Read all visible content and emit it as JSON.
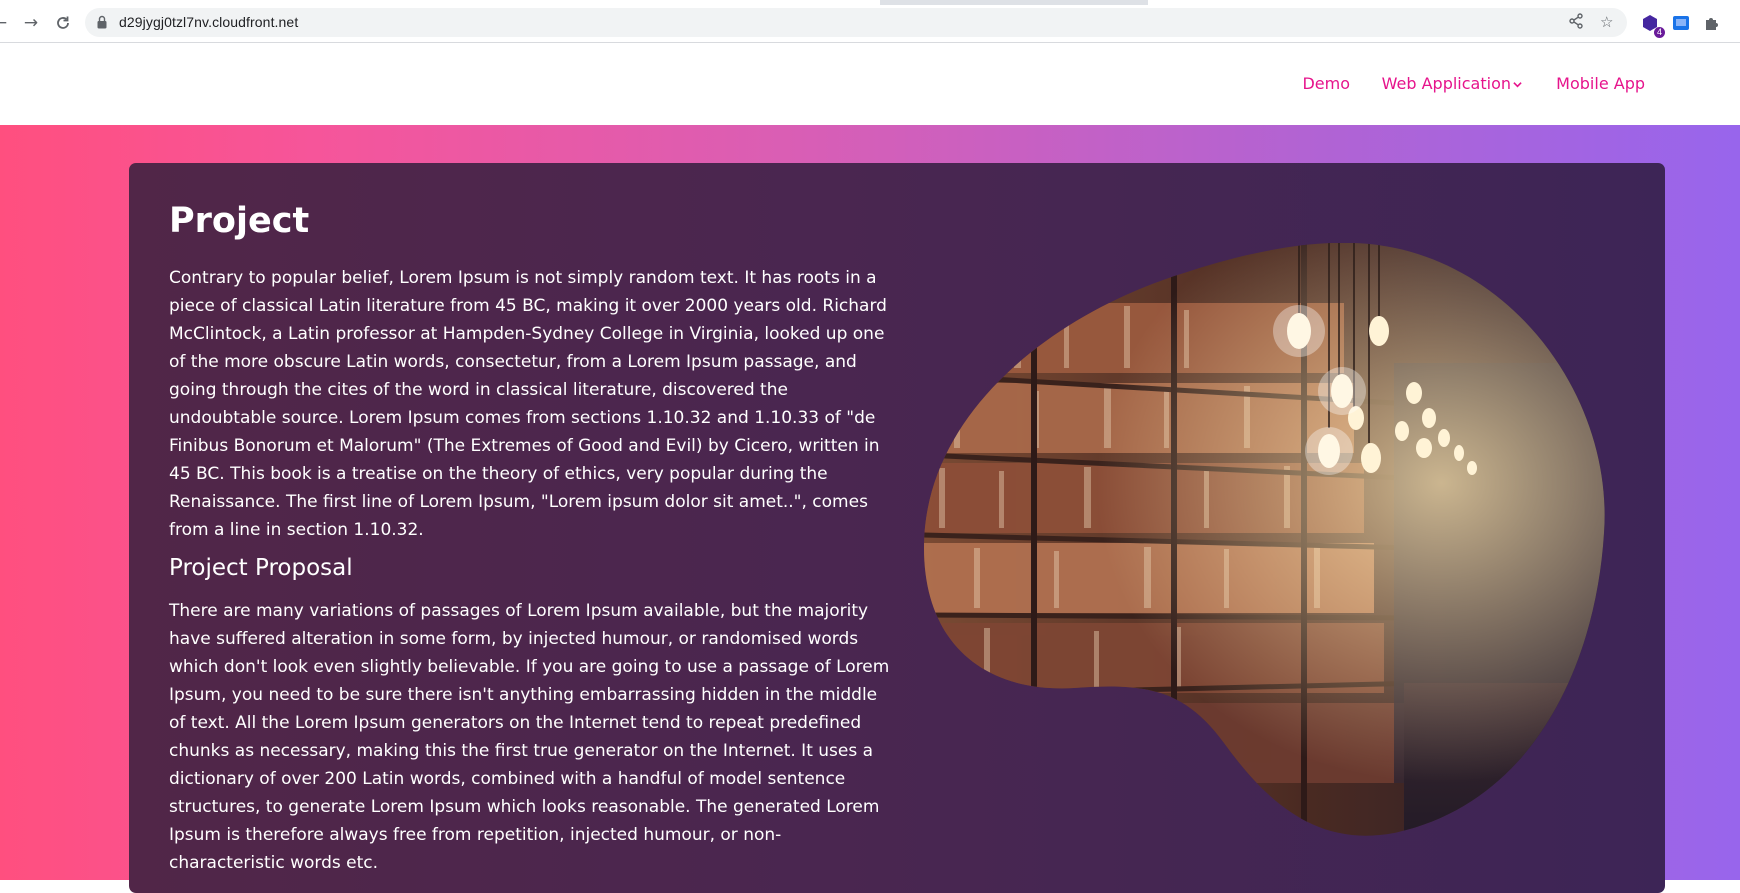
{
  "browser": {
    "url": "d29jygj0tzl7nv.cloudfront.net",
    "extension_badge": "4"
  },
  "nav": {
    "items": [
      {
        "label": "Demo"
      },
      {
        "label": "Web Application"
      },
      {
        "label": "Mobile App"
      }
    ]
  },
  "content": {
    "title": "Project",
    "intro": "Contrary to popular belief, Lorem Ipsum is not simply random text. It has roots in a piece of classical Latin literature from 45 BC, making it over 2000 years old. Richard McClintock, a Latin professor at Hampden-Sydney College in Virginia, looked up one of the more obscure Latin words, consectetur, from a Lorem Ipsum passage, and going through the cites of the word in classical literature, discovered the undoubtable source. Lorem Ipsum comes from sections 1.10.32 and 1.10.33 of \"de Finibus Bonorum et Malorum\" (The Extremes of Good and Evil) by Cicero, written in 45 BC. This book is a treatise on the theory of ethics, very popular during the Renaissance. The first line of Lorem Ipsum, \"Lorem ipsum dolor sit amet..\", comes from a line in section 1.10.32.",
    "subtitle": "Project Proposal",
    "proposal": "There are many variations of passages of Lorem Ipsum available, but the majority have suffered alteration in some form, by injected humour, or randomised words which don't look even slightly believable. If you are going to use a passage of Lorem Ipsum, you need to be sure there isn't anything embarrassing hidden in the middle of text. All the Lorem Ipsum generators on the Internet tend to repeat predefined chunks as necessary, making this the first true generator on the Internet. It uses a dictionary of over 200 Latin words, combined with a handful of model sentence structures, to generate Lorem Ipsum which looks reasonable. The generated Lorem Ipsum is therefore always free from repetition, injected humour, or non-characteristic words etc.",
    "image_subject": "library-bookshelves-with-hanging-bulbs"
  },
  "colors": {
    "accent": "#e6148c",
    "gradient_start": "#ff4f7f",
    "gradient_end": "#9865ec",
    "card": "#4a2650"
  }
}
